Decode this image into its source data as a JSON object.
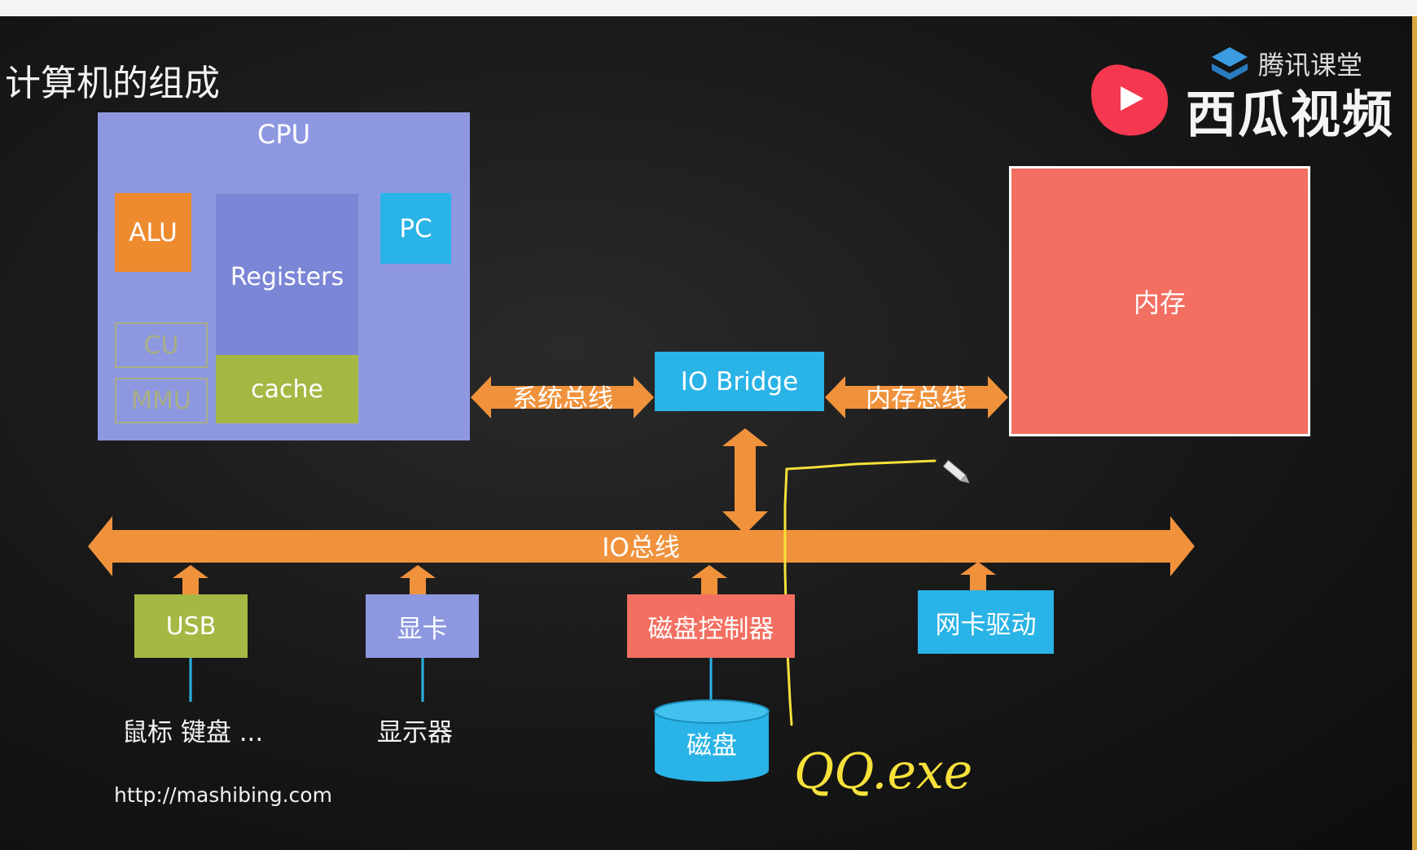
{
  "title": "计算机的组成",
  "watermark": {
    "small": "腾讯课堂",
    "main": "西瓜视频"
  },
  "cpu": {
    "label": "CPU",
    "alu": "ALU",
    "registers": "Registers",
    "pc": "PC",
    "cu": "CU",
    "mmu": "MMU",
    "cache": "cache"
  },
  "buses": {
    "system": "系统总线",
    "memory": "内存总线",
    "io": "IO总线"
  },
  "io_bridge": "IO Bridge",
  "memory": "内存",
  "devices": {
    "usb": "USB",
    "gpu": "显卡",
    "disk_controller": "磁盘控制器",
    "nic": "网卡驱动"
  },
  "peripherals": {
    "mouse_keyboard": "鼠标 键盘 ...",
    "monitor": "显示器",
    "disk": "磁盘"
  },
  "annotation": "QQ.exe",
  "url": "http://mashibing.com",
  "colors": {
    "cpu": "#8e98e0",
    "alu": "#ee8b2f",
    "registers": "#7c86d6",
    "pc": "#2ab3e6",
    "cache": "#a5b844",
    "bus": "#f0923c",
    "memory": "#f26f61",
    "annotation": "#f7e13a"
  },
  "icons": [
    "xigua-logo-icon",
    "tencent-classroom-icon",
    "pen-cursor-icon"
  ]
}
